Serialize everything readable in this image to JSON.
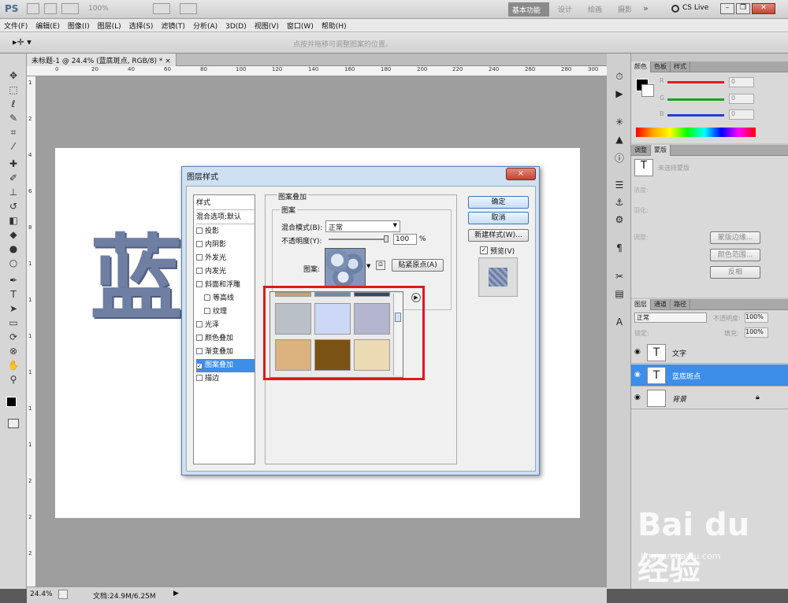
{
  "app": {
    "logo": "PS",
    "zoom": "100%",
    "workspaces": [
      "基本功能",
      "设计",
      "绘画",
      "摄影"
    ],
    "more": "»",
    "cslive": "CS Live"
  },
  "menu": [
    "文件(F)",
    "编辑(E)",
    "图像(I)",
    "图层(L)",
    "选择(S)",
    "滤镜(T)",
    "分析(A)",
    "3D(D)",
    "视图(V)",
    "窗口(W)",
    "帮助(H)"
  ],
  "options_hint": "点按并拖移可调整图案的位置。",
  "document": {
    "tab_title": "未标题-1 @ 24.4% (蓝底斑点, RGB/8) *",
    "tab_close": "×",
    "ruler_h": [
      "0",
      "20",
      "40",
      "60",
      "80",
      "100",
      "120",
      "140",
      "160",
      "180",
      "200",
      "220",
      "240",
      "260",
      "280",
      "300"
    ],
    "ruler_v": [
      "1",
      "2",
      "4",
      "6",
      "8",
      "1",
      "1",
      "1",
      "1",
      "1",
      "1",
      "2",
      "2",
      "2"
    ],
    "canvas_text": "蓝底斑点",
    "text_color": "#6f7fa3"
  },
  "status": {
    "zoom": "24.4%",
    "docsize": "文档:24.9M/6.25M"
  },
  "dialog": {
    "title": "图层样式",
    "close": "×",
    "styles_header": "样式",
    "blend_options": "混合选项:默认",
    "styles": [
      "投影",
      "内阴影",
      "外发光",
      "内发光",
      "斜面和浮雕",
      "等高线",
      "纹理",
      "光泽",
      "颜色叠加",
      "渐变叠加",
      "图案叠加",
      "描边"
    ],
    "checked_style": "图案叠加",
    "section_title": "图案叠加",
    "group_title": "图案",
    "blend_mode_label": "混合模式(B):",
    "blend_mode_value": "正常",
    "opacity_label": "不透明度(Y):",
    "opacity_value": "100",
    "opacity_unit": "%",
    "pattern_label": "图案:",
    "snap_button": "贴紧原点(A)",
    "ok": "确定",
    "cancel": "取消",
    "new_style": "新建样式(W)...",
    "preview": "预览(V)",
    "tile_colors": [
      "#b9c0c8",
      "#cdd7f6",
      "#b4b6cf",
      "#dcb27e",
      "#7a5314",
      "#ecdab2"
    ],
    "highlight_color": "#e0181b"
  },
  "panels": {
    "color_tabs": [
      "颜色",
      "色板",
      "样式"
    ],
    "color_channels": [
      {
        "label": "R",
        "value": "0",
        "color": "#d92020"
      },
      {
        "label": "G",
        "value": "0",
        "color": "#20a020"
      },
      {
        "label": "B",
        "value": "0",
        "color": "#2040d0"
      }
    ],
    "adjust_tabs": [
      "调整",
      "蒙版"
    ],
    "mask_hint": "未选择蒙版",
    "density_label": "浓度:",
    "feather_label": "羽化:",
    "refine_label": "调整:",
    "mask_edge_btn": "蒙版边缘...",
    "color_range_btn": "颜色范围...",
    "invert_btn": "反相",
    "layers_tabs": [
      "图层",
      "通道",
      "路径"
    ],
    "layer_blend": "正常",
    "layer_opacity_label": "不透明度:",
    "layer_opacity": "100%",
    "lock_label": "锁定:",
    "fill_label": "填充:",
    "fill_value": "100%",
    "layers": [
      {
        "name": "文字",
        "type": "T",
        "selected": false
      },
      {
        "name": "蓝底斑点",
        "type": "T",
        "selected": true
      },
      {
        "name": "背景",
        "type": "",
        "selected": false
      }
    ]
  },
  "watermark": {
    "brand": "Bai du 经验",
    "url": "jingyan.baidu.com"
  }
}
